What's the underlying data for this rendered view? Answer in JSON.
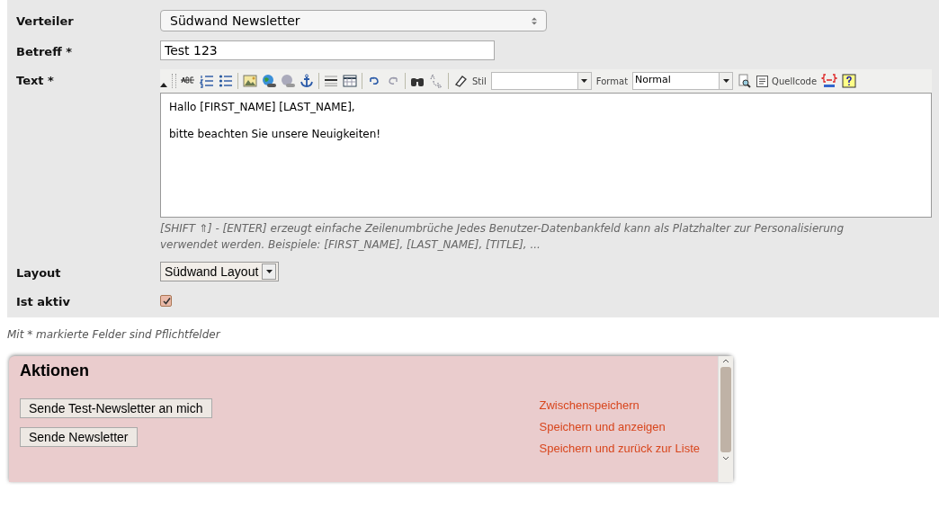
{
  "form": {
    "fields": [
      {
        "kind": "select",
        "label": "Verteiler",
        "value": "Südwand Newsletter"
      },
      {
        "kind": "text",
        "label": "Betreff *",
        "value": "Test 123"
      },
      {
        "kind": "editor",
        "label": "Text *",
        "toolbar": {
          "style_label": "Stil",
          "format_label": "Format",
          "format_value": "Normal",
          "source_label": "Quellcode"
        },
        "paragraphs": [
          "Hallo [FIRST_NAME] [LAST_NAME],",
          "bitte beachten Sie unsere Neuigkeiten!"
        ],
        "hint": "[SHIFT ⇑] - [ENTER] erzeugt einfache Zeilenumbrüche Jedes Benutzer-Datenbankfeld kann als Platzhalter zur Personalisierung verwendet werden. Beispiele: [FIRST_NAME], [LAST_NAME], [TITLE], ..."
      },
      {
        "kind": "dropdown",
        "label": "Layout",
        "value": "Südwand Layout"
      },
      {
        "kind": "checkbox",
        "label": "Ist aktiv",
        "checked": true
      }
    ]
  },
  "note": "Mit * markierte Felder sind Pflichtfelder",
  "actions": {
    "title": "Aktionen",
    "buttons": [
      "Sende Test-Newsletter an mich",
      "Sende Newsletter"
    ],
    "links": [
      "Zwischenspeichern",
      "Speichern und anzeigen",
      "Speichern und zurück zur Liste"
    ]
  }
}
